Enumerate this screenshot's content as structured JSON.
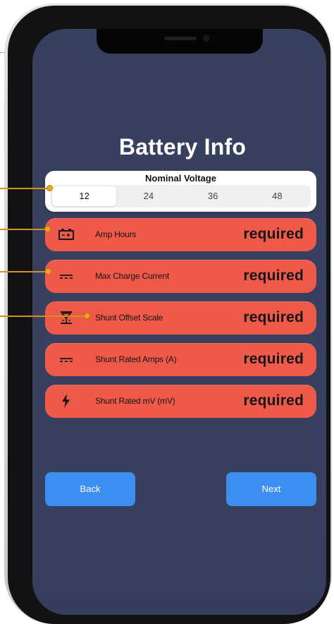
{
  "screen": {
    "title": "Battery Info"
  },
  "voltage": {
    "label": "Nominal Voltage",
    "options": [
      "12",
      "24",
      "36",
      "48"
    ],
    "selected": "12"
  },
  "fields": [
    {
      "label": "Amp Hours",
      "value": "required",
      "icon": "battery-icon"
    },
    {
      "label": "Max Charge Current",
      "value": "required",
      "icon": "dc-current-icon"
    },
    {
      "label": "Shunt Offset Scale",
      "value": "required",
      "icon": "shunt-offset-icon"
    },
    {
      "label": "Shunt Rated Amps (A)",
      "value": "required",
      "icon": "dc-current-icon"
    },
    {
      "label": "Shunt Rated mV (mV)",
      "value": "required",
      "icon": "lightning-bolt-icon"
    }
  ],
  "buttons": {
    "back": "Back",
    "next": "Next"
  },
  "colors": {
    "screen_background": "#37405f",
    "field_background": "#ef594a",
    "button_blue": "#3c8ef0",
    "callout_orange": "#f0a51a"
  }
}
